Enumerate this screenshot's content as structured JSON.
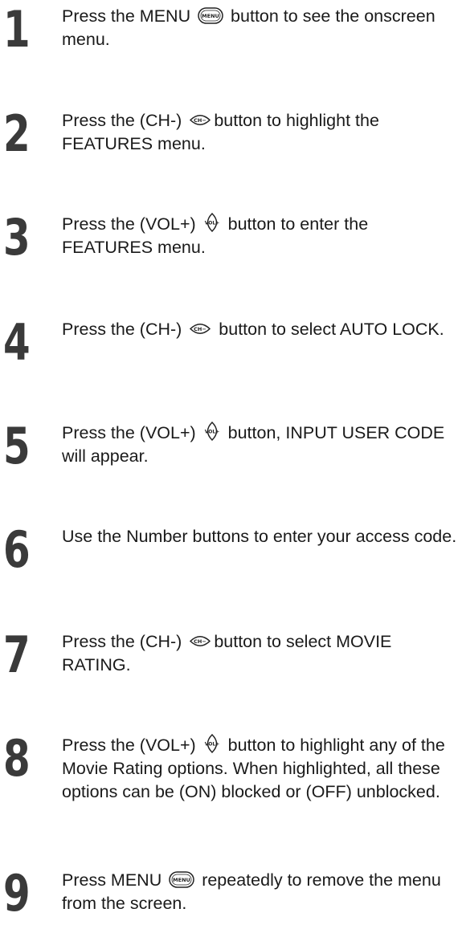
{
  "steps": [
    {
      "number": "1",
      "parts": [
        "Press the MENU ",
        " button to see the onscreen menu."
      ],
      "button": {
        "icon": "menu-button-icon",
        "label": "MENU"
      }
    },
    {
      "number": "2",
      "parts": [
        "Press the (CH-) ",
        "button to highlight the FEATURES menu."
      ],
      "button": {
        "icon": "ch-minus-button-icon",
        "label": "CH−"
      }
    },
    {
      "number": "3",
      "parts": [
        "Press the (VOL+) ",
        " button to enter the FEATURES menu."
      ],
      "button": {
        "icon": "vol-plus-button-icon",
        "label": "VOL+"
      }
    },
    {
      "number": "4",
      "parts": [
        "Press the (CH-) ",
        " button to select AUTO LOCK."
      ],
      "button": {
        "icon": "ch-minus-button-icon",
        "label": "CH−"
      }
    },
    {
      "number": "5",
      "parts": [
        "Press the (VOL+) ",
        " button, INPUT USER CODE will appear."
      ],
      "button": {
        "icon": "vol-plus-button-icon",
        "label": "VOL+"
      }
    },
    {
      "number": "6",
      "parts": [
        "Use the Number buttons to enter your access code.",
        ""
      ]
    },
    {
      "number": "7",
      "parts": [
        "Press the (CH-) ",
        "button to select MOVIE RATING."
      ],
      "button": {
        "icon": "ch-minus-button-icon",
        "label": "CH−"
      }
    },
    {
      "number": "8",
      "parts": [
        "Press the (VOL+) ",
        " button to highlight any of the Movie Rating options. When highlighted, all these options can be (ON) blocked or (OFF) unblocked."
      ],
      "button": {
        "icon": "vol-plus-button-icon",
        "label": "VOL+"
      }
    },
    {
      "number": "9",
      "parts": [
        "Press MENU ",
        " repeatedly to remove the menu from the screen."
      ],
      "button": {
        "icon": "menu-button-icon",
        "label": "MENU"
      }
    }
  ]
}
